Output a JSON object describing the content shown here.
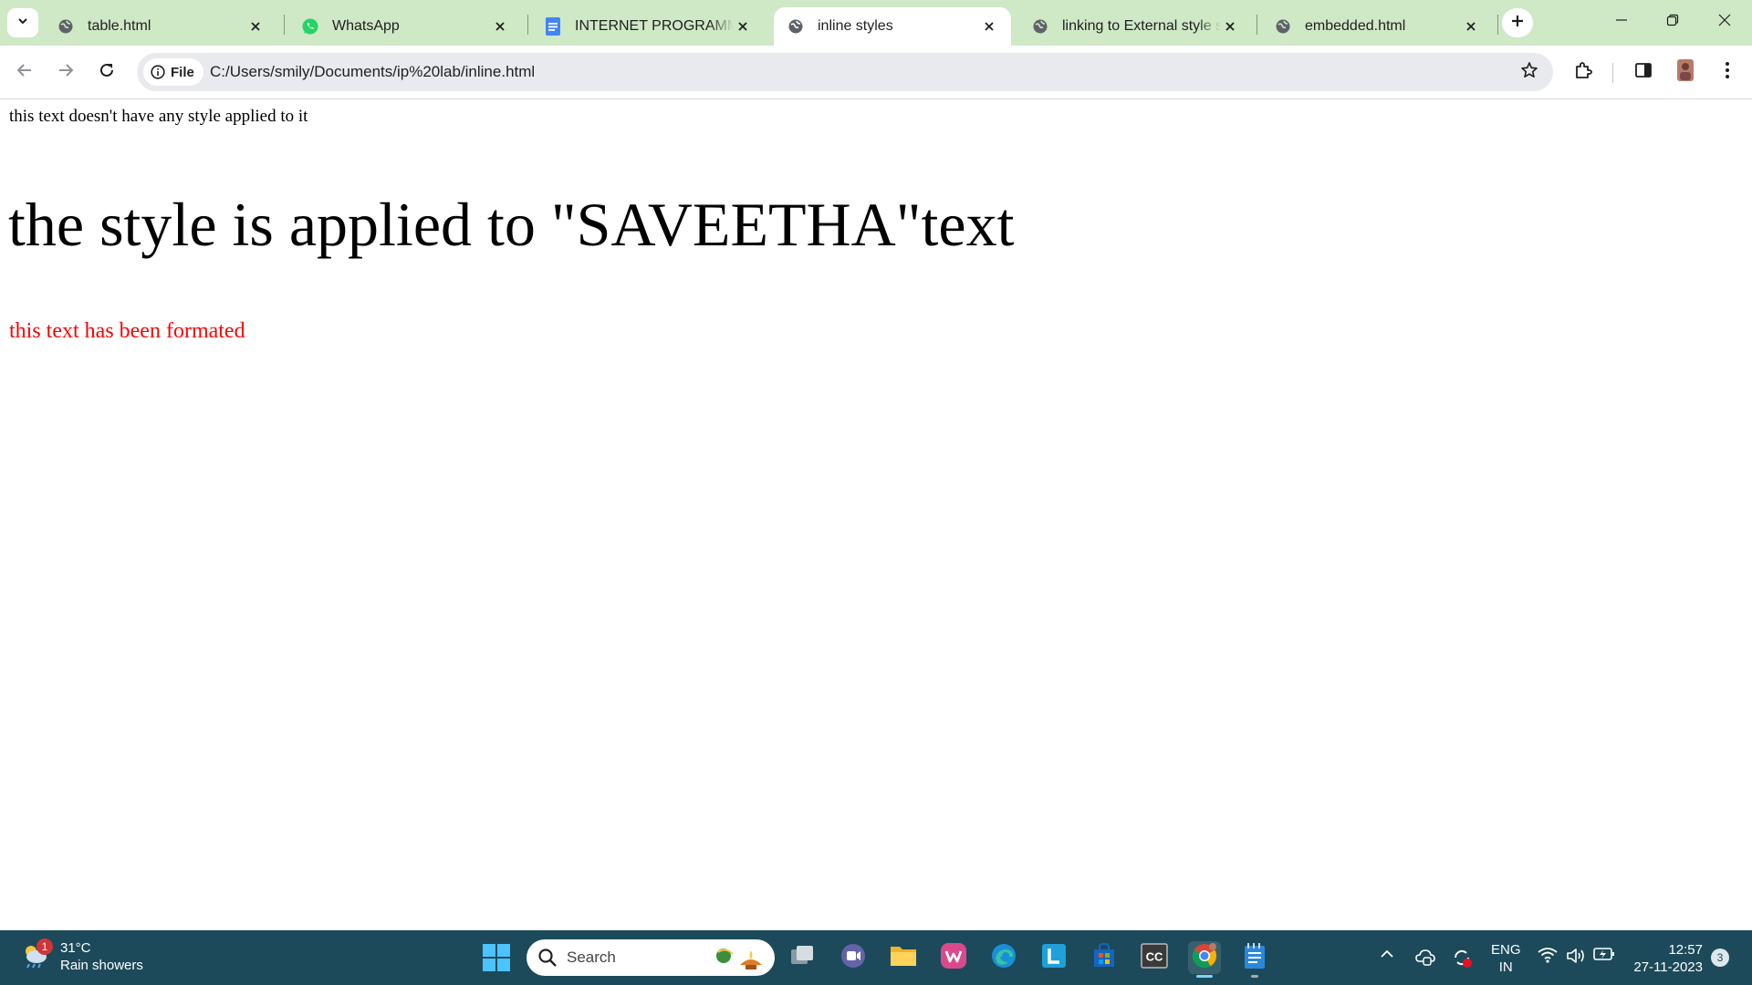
{
  "tabs": [
    {
      "title": "table.html",
      "favicon": "globe-icon"
    },
    {
      "title": "WhatsApp",
      "favicon": "whatsapp-icon"
    },
    {
      "title": "INTERNET PROGRAMMIN",
      "favicon": "docs-icon"
    },
    {
      "title": "inline styles",
      "favicon": "globe-icon",
      "active": true
    },
    {
      "title": "linking to External style sh",
      "favicon": "globe-icon"
    },
    {
      "title": "embedded.html",
      "favicon": "globe-icon"
    }
  ],
  "address_bar": {
    "chip_label": "File",
    "url": "C:/Users/smily/Documents/ip%20lab/inline.html"
  },
  "page": {
    "plain_text": "this text doesn't have any style applied to it",
    "heading": "the style is applied to \"SAVEETHA\"text",
    "formatted_text": "this text has been formated",
    "formatted_color": "#ff0000"
  },
  "taskbar": {
    "weather_badge": "1",
    "temperature": "31°C",
    "weather_desc": "Rain showers",
    "search_placeholder": "Search",
    "language_line1": "ENG",
    "language_line2": "IN",
    "time": "12:57",
    "date": "27-11-2023",
    "notification_count": "3"
  },
  "colors": {
    "tabstrip": "#cfe8c6",
    "taskbar": "#1c4a5a"
  }
}
